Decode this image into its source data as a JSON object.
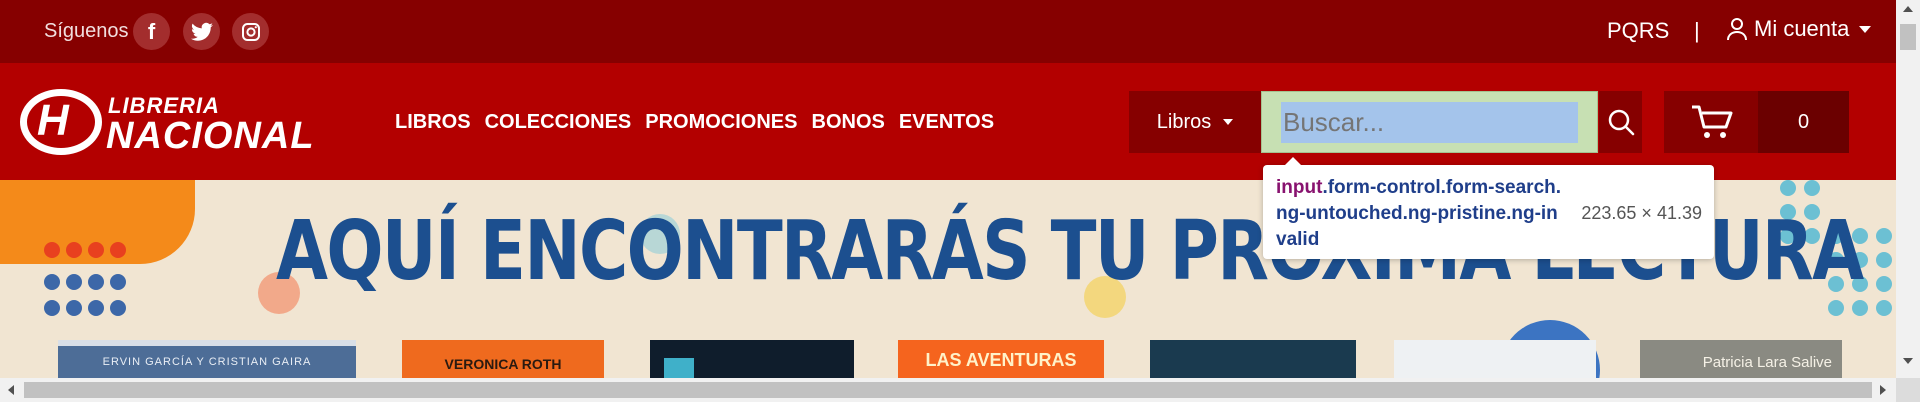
{
  "topbar": {
    "follow_label": "Síguenos",
    "social": [
      {
        "icon": "facebook-icon",
        "glyph": "f"
      },
      {
        "icon": "twitter-icon",
        "glyph": "t"
      },
      {
        "icon": "instagram-icon",
        "glyph": "◎"
      }
    ],
    "pqrs_label": "PQRS",
    "separator": "|",
    "account_label": "Mi cuenta"
  },
  "header": {
    "logo_top": "LIBRERIA",
    "logo_bottom": "NACIONAL",
    "nav": [
      "LIBROS",
      "COLECCIONES",
      "PROMOCIONES",
      "BONOS",
      "EVENTOS"
    ],
    "category_select": "Libros",
    "search_placeholder": "Buscar...",
    "cart_count": "0"
  },
  "inspector_tooltip": {
    "tag": "input",
    "classes": ".form-control.form-search.ng-untouched.ng-pristine.ng-invalid",
    "size": "223.65 × 41.39"
  },
  "banner": {
    "title": "AQUÍ ENCONTRARÁS TU PRÓXIMA LECTURA",
    "book_texts": [
      "ERVIN GARCÍA Y CRISTIAN GAIRA",
      "VERONICA ROTH",
      "LAS AVENTURAS",
      "Patricia Lara Salive"
    ]
  },
  "colors": {
    "topbar": "#860000",
    "mainbar": "#b30000",
    "banner_bg": "#f1e5d2",
    "banner_title": "#1c4f8f"
  }
}
